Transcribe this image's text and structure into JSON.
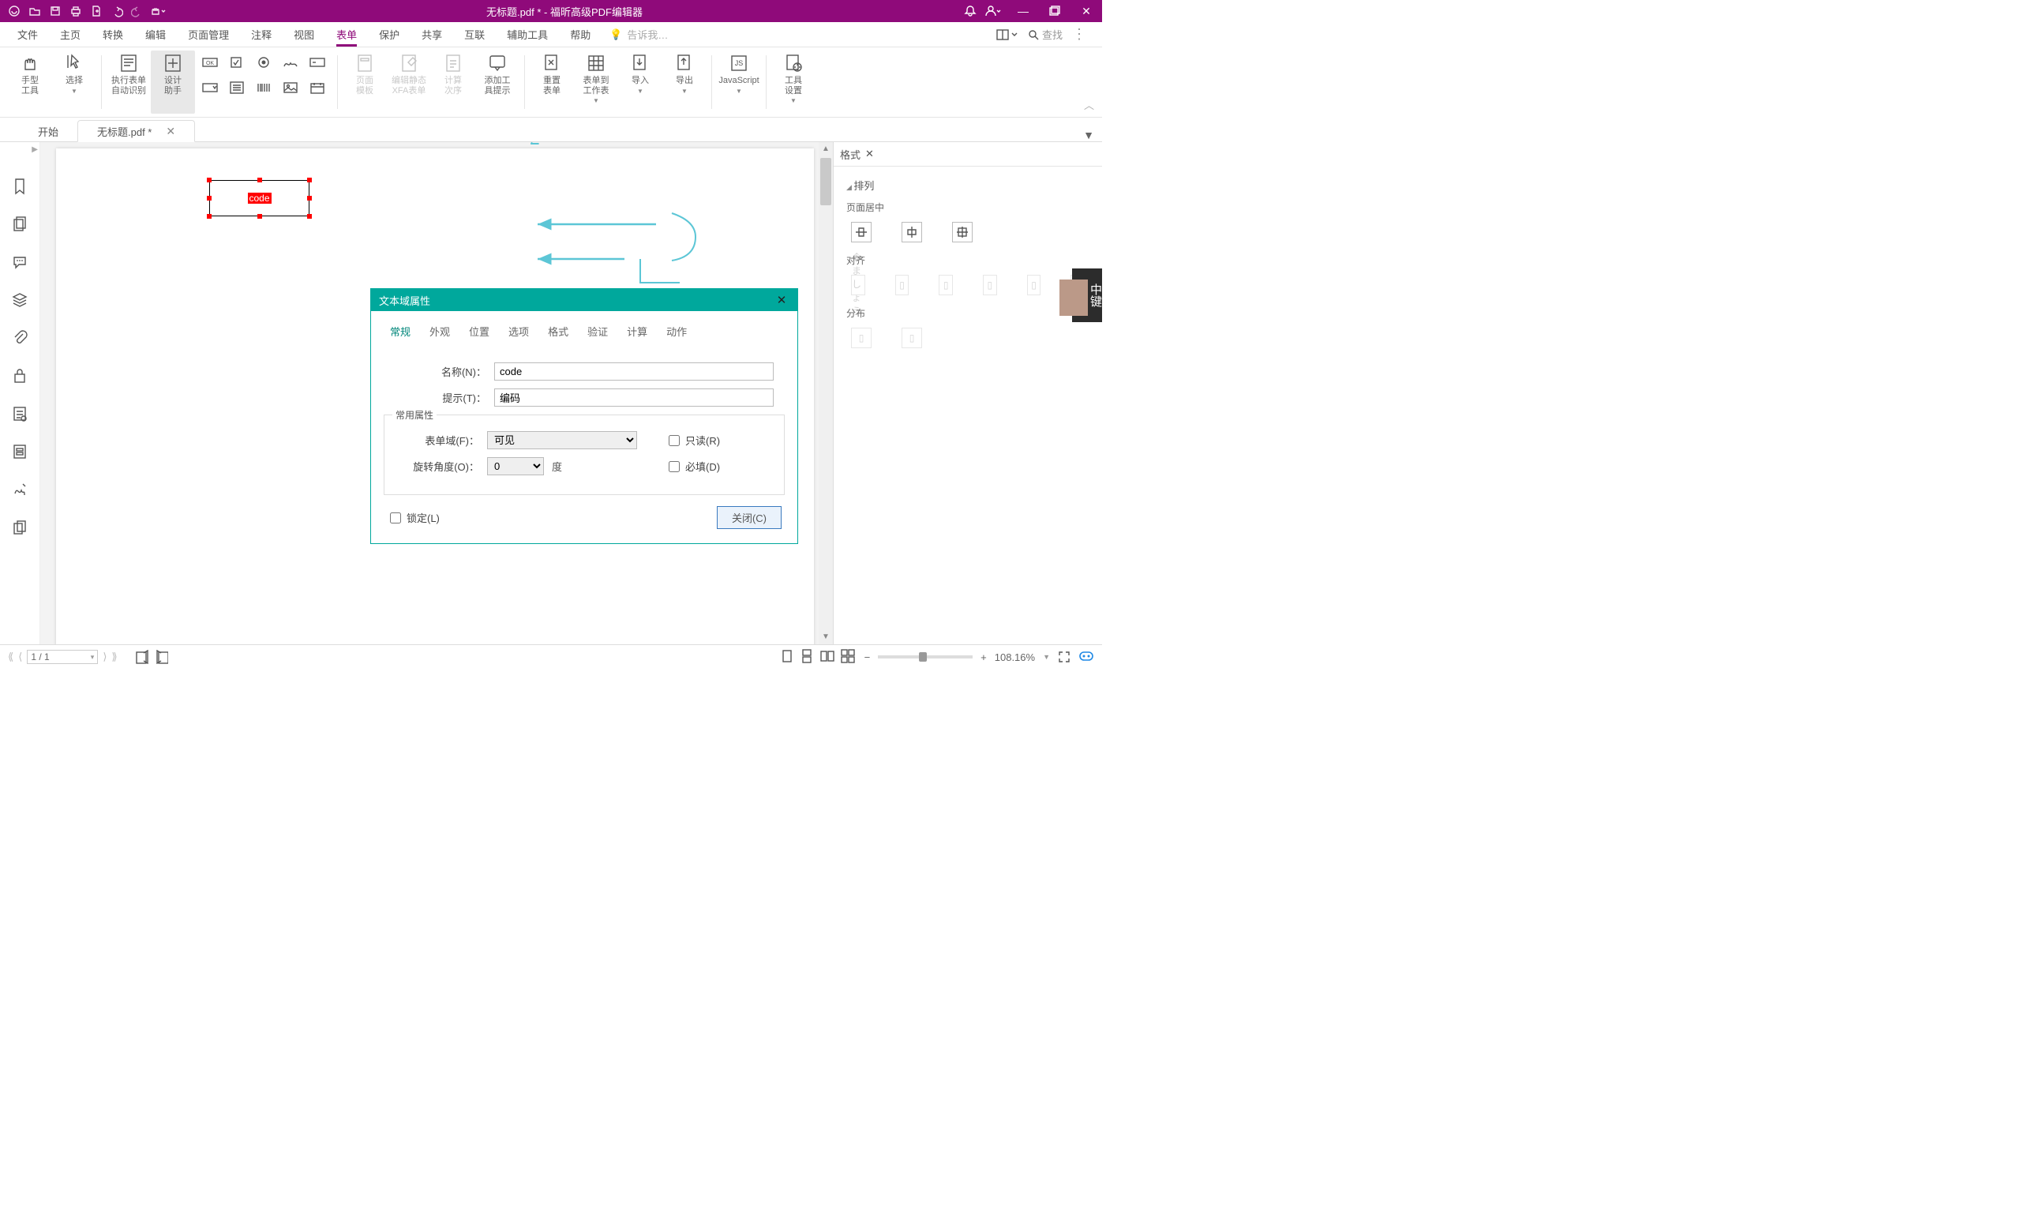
{
  "titlebar": {
    "doc_title": "无标题.pdf * - 福昕高级PDF编辑器"
  },
  "menu": {
    "file": "文件",
    "home": "主页",
    "convert": "转换",
    "edit": "编辑",
    "page_manage": "页面管理",
    "annotate": "注释",
    "view": "视图",
    "form": "表单",
    "protect": "保护",
    "share": "共享",
    "connect": "互联",
    "accessibility": "辅助工具",
    "help": "帮助",
    "tell_me_placeholder": "告诉我…",
    "find_placeholder": "查找"
  },
  "ribbon": {
    "hand_tool": "手型\n工具",
    "select": "选择",
    "run_form_auto": "执行表单\n自动识别",
    "design_assistant": "设计\n助手",
    "page_template": "页面\n模板",
    "edit_static_xfa": "编辑静态\nXFA表单",
    "calc_order": "计算\n次序",
    "tooltip": "添加工\n具提示",
    "reset_form": "重置\n表单",
    "form_to_sheet": "表单到\n工作表",
    "import": "导入",
    "export": "导出",
    "javascript": "JavaScript",
    "tool_settings": "工具\n设置"
  },
  "doc_tabs": {
    "start": "开始",
    "current": "无标题.pdf *"
  },
  "page": {
    "field_label": "code"
  },
  "dialog": {
    "title": "文本域属性",
    "tabs": {
      "general": "常规",
      "appearance": "外观",
      "position": "位置",
      "options": "选项",
      "format": "格式",
      "validate": "验证",
      "calculate": "计算",
      "actions": "动作"
    },
    "name_label": "名称(N)：",
    "name_value": "code",
    "tooltip_label": "提示(T)：",
    "tooltip_value": "编码",
    "common_props": "常用属性",
    "form_field_label": "表单域(F)：",
    "form_field_value": "可见",
    "readonly_label": "只读(R)",
    "rotate_label": "旋转角度(O)：",
    "rotate_value": "0",
    "degree": "度",
    "required_label": "必填(D)",
    "lock_label": "锁定(L)",
    "close_btn": "关闭(C)"
  },
  "right_panel": {
    "tab": "格式",
    "arrange": "排列",
    "page_center": "页面居中",
    "align": "对齐",
    "distribute": "分布"
  },
  "statusbar": {
    "page": "1 / 1",
    "zoom": "108.16%"
  },
  "sidebadge": "中键"
}
